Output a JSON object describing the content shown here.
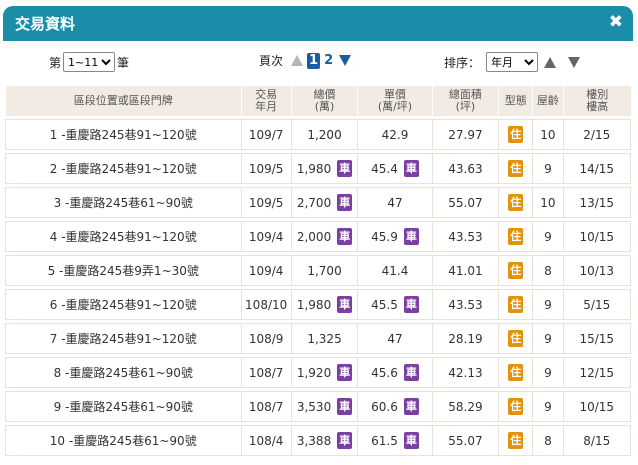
{
  "dialog": {
    "title": "交易資料",
    "close_label": "✖"
  },
  "controls": {
    "page_prefix": "第",
    "page_select_value": "1~11",
    "page_suffix": "筆",
    "pager_label": "頁次",
    "pages": [
      "1",
      "2"
    ],
    "current_page": "1",
    "sort_label": "排序：",
    "sort_select_value": "年月"
  },
  "table": {
    "headers": [
      "區段位置或區段門牌",
      "交易\n年月",
      "總價\n(萬)",
      "單價\n(萬/坪)",
      "總面積\n(坪)",
      "型態",
      "屋齡",
      "樓別\n樓高"
    ],
    "rows": [
      {
        "addr": "1 -重慶路245巷91~120號",
        "date": "109/7",
        "total": "1,200",
        "total_car": false,
        "unit": "42.9",
        "unit_car": false,
        "area": "27.97",
        "type": "住",
        "age": "10",
        "floor": "2/15"
      },
      {
        "addr": "2 -重慶路245巷91~120號",
        "date": "109/5",
        "total": "1,980",
        "total_car": true,
        "unit": "45.4",
        "unit_car": true,
        "area": "43.63",
        "type": "住",
        "age": "9",
        "floor": "14/15"
      },
      {
        "addr": "3 -重慶路245巷61~90號",
        "date": "109/5",
        "total": "2,700",
        "total_car": true,
        "unit": "47",
        "unit_car": false,
        "area": "55.07",
        "type": "住",
        "age": "10",
        "floor": "13/15"
      },
      {
        "addr": "4 -重慶路245巷91~120號",
        "date": "109/4",
        "total": "2,000",
        "total_car": true,
        "unit": "45.9",
        "unit_car": true,
        "area": "43.53",
        "type": "住",
        "age": "9",
        "floor": "10/15"
      },
      {
        "addr": "5 -重慶路245巷9弄1~30號",
        "date": "109/4",
        "total": "1,700",
        "total_car": false,
        "unit": "41.4",
        "unit_car": false,
        "area": "41.01",
        "type": "住",
        "age": "8",
        "floor": "10/13"
      },
      {
        "addr": "6 -重慶路245巷91~120號",
        "date": "108/10",
        "total": "1,980",
        "total_car": true,
        "unit": "45.5",
        "unit_car": true,
        "area": "43.53",
        "type": "住",
        "age": "9",
        "floor": "5/15"
      },
      {
        "addr": "7 -重慶路245巷91~120號",
        "date": "108/9",
        "total": "1,325",
        "total_car": false,
        "unit": "47",
        "unit_car": false,
        "area": "28.19",
        "type": "住",
        "age": "9",
        "floor": "15/15"
      },
      {
        "addr": "8 -重慶路245巷61~90號",
        "date": "108/7",
        "total": "1,920",
        "total_car": true,
        "unit": "45.6",
        "unit_car": true,
        "area": "42.13",
        "type": "住",
        "age": "9",
        "floor": "12/15"
      },
      {
        "addr": "9 -重慶路245巷61~90號",
        "date": "108/7",
        "total": "3,530",
        "total_car": true,
        "unit": "60.6",
        "unit_car": true,
        "area": "58.29",
        "type": "住",
        "age": "9",
        "floor": "10/15"
      },
      {
        "addr": "10 -重慶路245巷61~90號",
        "date": "108/4",
        "total": "3,388",
        "total_car": true,
        "unit": "61.5",
        "unit_car": true,
        "area": "55.07",
        "type": "住",
        "age": "8",
        "floor": "8/15"
      }
    ],
    "car_badge": "車"
  },
  "colors": {
    "titlebar": "#1a8ea8",
    "header_bg": "#f1ebe4",
    "car_badge": "#7a3fa0",
    "type_badge": "#e2920b",
    "pager_accent": "#1b5e9e"
  }
}
